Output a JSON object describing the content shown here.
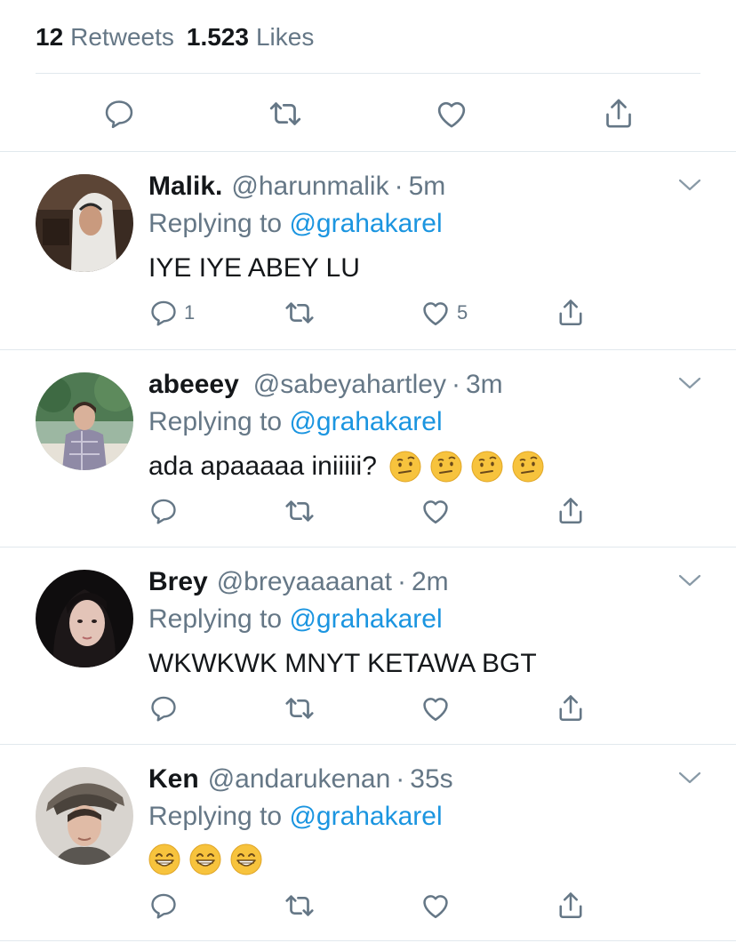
{
  "stats": {
    "retweets_count": "12",
    "retweets_label": "Retweets",
    "likes_count": "1.523",
    "likes_label": "Likes"
  },
  "icons": {
    "reply": "reply-icon",
    "retweet": "retweet-icon",
    "like": "like-icon",
    "share": "share-icon",
    "more": "chevron-down-icon"
  },
  "colors": {
    "text": "#14171a",
    "muted": "#657786",
    "link": "#1b95e0",
    "divider": "#e1e8ed"
  },
  "replies": [
    {
      "name": "Malik.",
      "handle": "@harunmalik",
      "sep": "·",
      "time": "5m",
      "replying_label": "Replying to",
      "replying_to": "@grahakarel",
      "text": "IYE IYE ABEY LU",
      "emojis": [],
      "reply_count": "1",
      "like_count": "5"
    },
    {
      "name": "abeeey",
      "handle": "@sabeyahartley",
      "sep": "·",
      "time": "3m",
      "replying_label": "Replying to",
      "replying_to": "@grahakarel",
      "text": "ada apaaaaa iniiiii?",
      "emojis": [
        "face-with-raised-eyebrow",
        "face-with-raised-eyebrow",
        "face-with-raised-eyebrow",
        "face-with-raised-eyebrow"
      ],
      "reply_count": "",
      "like_count": ""
    },
    {
      "name": "Brey",
      "handle": "@breyaaaanat",
      "sep": "·",
      "time": "2m",
      "replying_label": "Replying to",
      "replying_to": "@grahakarel",
      "text": "WKWKWK MNYT KETAWA BGT",
      "emojis": [],
      "reply_count": "",
      "like_count": ""
    },
    {
      "name": "Ken",
      "handle": "@andarukenan",
      "sep": "·",
      "time": "35s",
      "replying_label": "Replying to",
      "replying_to": "@grahakarel",
      "text": "",
      "emojis": [
        "grinning-face-with-smiling-eyes",
        "grinning-face-with-smiling-eyes",
        "grinning-face-with-smiling-eyes"
      ],
      "reply_count": "",
      "like_count": ""
    }
  ]
}
